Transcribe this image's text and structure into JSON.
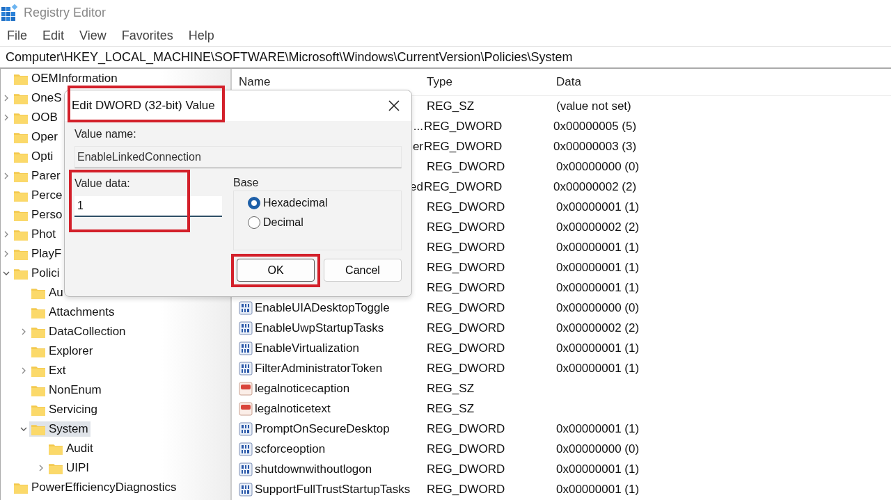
{
  "window": {
    "title": "Registry Editor"
  },
  "menu": [
    "File",
    "Edit",
    "View",
    "Favorites",
    "Help"
  ],
  "address": "Computer\\HKEY_LOCAL_MACHINE\\SOFTWARE\\Microsoft\\Windows\\CurrentVersion\\Policies\\System",
  "tree": [
    {
      "label": "OEMInformation"
    },
    {
      "label": "OneS",
      "expanded": false
    },
    {
      "label": "OOB",
      "expanded": false
    },
    {
      "label": "Oper"
    },
    {
      "label": "Opti"
    },
    {
      "label": "Parer",
      "expanded": false
    },
    {
      "label": "Perce"
    },
    {
      "label": "Perso"
    },
    {
      "label": "Phot",
      "expanded": false
    },
    {
      "label": "PlayF",
      "expanded": false
    },
    {
      "label": "Polici",
      "expanded": true,
      "children": [
        {
          "label": "Au"
        },
        {
          "label": "Attachments"
        },
        {
          "label": "DataCollection",
          "expanded": false
        },
        {
          "label": "Explorer"
        },
        {
          "label": "Ext",
          "expanded": false
        },
        {
          "label": "NonEnum"
        },
        {
          "label": "Servicing"
        },
        {
          "label": "System",
          "expanded": true,
          "selected": true,
          "children": [
            {
              "label": "Audit"
            },
            {
              "label": "UIPI",
              "expanded": false
            }
          ]
        }
      ]
    },
    {
      "label": "PowerEfficiencyDiagnostics"
    }
  ],
  "list": {
    "columns": [
      "Name",
      "Type",
      "Data"
    ],
    "rows": [
      {
        "type": "REG_SZ",
        "data": "(value not set)"
      },
      {
        "name": "...",
        "kind": "covered",
        "type": "REG_DWORD",
        "data": "0x00000005 (5)"
      },
      {
        "name": "er",
        "kind": "covered",
        "type": "REG_DWORD",
        "data": "0x00000003 (3)"
      },
      {
        "type": "REG_DWORD",
        "data": "0x00000000 (0)"
      },
      {
        "name": "ed",
        "kind": "covered",
        "type": "REG_DWORD",
        "data": "0x00000002 (2)"
      },
      {
        "type": "REG_DWORD",
        "data": "0x00000001 (1)"
      },
      {
        "type": "REG_DWORD",
        "data": "0x00000002 (2)"
      },
      {
        "type": "REG_DWORD",
        "data": "0x00000001 (1)"
      },
      {
        "type": "REG_DWORD",
        "data": "0x00000001 (1)"
      },
      {
        "type": "REG_DWORD",
        "data": "0x00000001 (1)"
      },
      {
        "name": "EnableUIADesktopToggle",
        "kind": "dword",
        "type": "REG_DWORD",
        "data": "0x00000000 (0)"
      },
      {
        "name": "EnableUwpStartupTasks",
        "kind": "dword",
        "type": "REG_DWORD",
        "data": "0x00000002 (2)"
      },
      {
        "name": "EnableVirtualization",
        "kind": "dword",
        "type": "REG_DWORD",
        "data": "0x00000001 (1)"
      },
      {
        "name": "FilterAdministratorToken",
        "kind": "dword",
        "type": "REG_DWORD",
        "data": "0x00000001 (1)"
      },
      {
        "name": "legalnoticecaption",
        "kind": "string",
        "type": "REG_SZ"
      },
      {
        "name": "legalnoticetext",
        "kind": "string",
        "type": "REG_SZ"
      },
      {
        "name": "PromptOnSecureDesktop",
        "kind": "dword",
        "type": "REG_DWORD",
        "data": "0x00000001 (1)"
      },
      {
        "name": "scforceoption",
        "kind": "dword",
        "type": "REG_DWORD",
        "data": "0x00000000 (0)"
      },
      {
        "name": "shutdownwithoutlogon",
        "kind": "dword",
        "type": "REG_DWORD",
        "data": "0x00000001 (1)"
      },
      {
        "name": "SupportFullTrustStartupTasks",
        "kind": "dword",
        "type": "REG_DWORD",
        "data": "0x00000001 (1)"
      }
    ]
  },
  "dialog": {
    "title": "Edit DWORD (32-bit) Value",
    "title_highlighted": true,
    "value_name_label": "Value name:",
    "value_name": "EnableLinkedConnection",
    "value_data_label": "Value data:",
    "value_data": "1",
    "value_data_highlighted": true,
    "base_label": "Base",
    "base_options": [
      {
        "label": "Hexadecimal",
        "selected": true
      },
      {
        "label": "Decimal",
        "selected": false
      }
    ],
    "buttons": [
      {
        "label": "OK",
        "highlighted": true
      },
      {
        "label": "Cancel",
        "highlighted": false
      }
    ]
  }
}
